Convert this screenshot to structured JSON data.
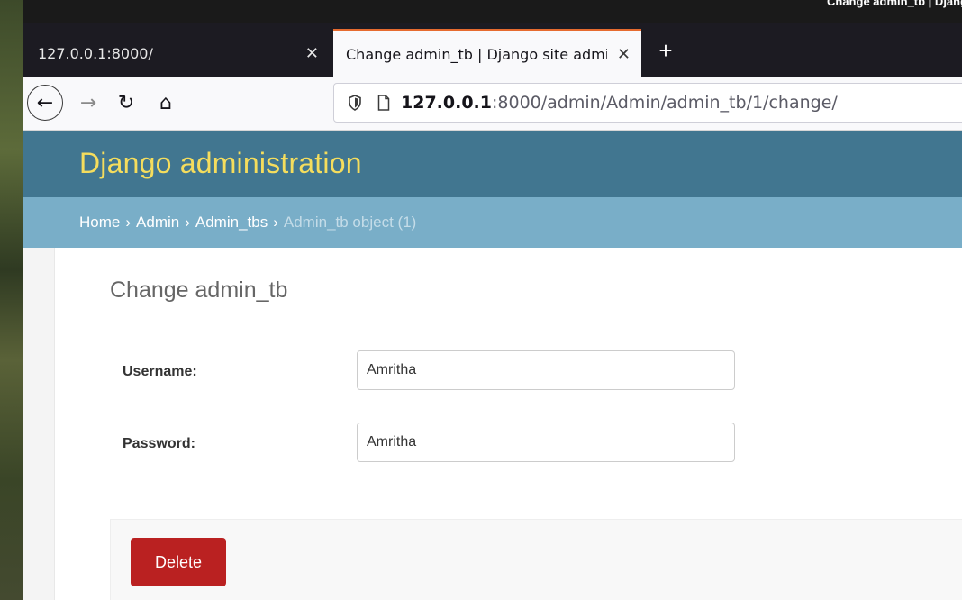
{
  "os_bar": {
    "title": "Change admin_tb | Django site"
  },
  "browser": {
    "tabs": [
      {
        "label": "127.0.0.1:8000/",
        "active": false
      },
      {
        "label": "Change admin_tb | Django site admin",
        "active": true
      }
    ],
    "new_tab_label": "+",
    "close_glyph": "✕",
    "url_host": "127.0.0.1",
    "url_rest": ":8000/admin/Admin/admin_tb/1/change/",
    "icons": {
      "back": "←",
      "forward": "→",
      "reload": "↻",
      "home": "⌂"
    }
  },
  "django": {
    "branding": "Django administration",
    "breadcrumbs": {
      "home": "Home",
      "app": "Admin",
      "model": "Admin_tbs",
      "current": "Admin_tb object (1)",
      "separator": "›"
    },
    "page_title": "Change admin_tb",
    "fields": {
      "username": {
        "label": "Username:",
        "value": "Amritha"
      },
      "password": {
        "label": "Password:",
        "value": "Amritha"
      }
    },
    "delete_label": "Delete"
  },
  "colors": {
    "header_bg": "#417690",
    "branding_text": "#f5dd5d",
    "breadcrumbs_bg": "#79aec8",
    "delete_bg": "#ba2121",
    "active_tab_accent": "#e66b2f"
  }
}
